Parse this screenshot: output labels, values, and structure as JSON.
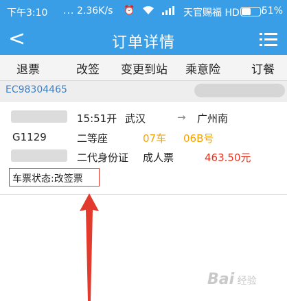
{
  "status_bar": {
    "time": "下午3:10",
    "dots": "...",
    "speed": "2.36K/s",
    "carrier": "天官赐福 HD",
    "battery": "51%",
    "battery_level": 0.51,
    "icons": [
      "alarm-icon",
      "wifi-icon",
      "signal-icon",
      "battery-icon"
    ]
  },
  "header": {
    "back_icon": "chevron-left-icon",
    "back_glyph": "<",
    "title": "订单详情",
    "menu_icon": "list-menu-icon"
  },
  "actions": [
    "退票",
    "改签",
    "变更到站",
    "乘意险",
    "订餐"
  ],
  "order": {
    "number": "EC98304465"
  },
  "ticket": {
    "train": "G1129",
    "time": "15:51开",
    "from": "武汉",
    "arrow": "→",
    "to": "广州南",
    "seat_class": "二等座",
    "car": "07车",
    "seat": "06B号",
    "id_type": "二代身份证",
    "ticket_type": "成人票",
    "price": "463.50元",
    "status_label": "车票状态:改签票"
  },
  "watermark": {
    "brand": "Bai",
    "suffix": "经验"
  },
  "colors": {
    "primary": "#3a9ee7",
    "accent_orange": "#f0a400",
    "price_red": "#e8341f",
    "highlight_red": "#e23b2e"
  }
}
